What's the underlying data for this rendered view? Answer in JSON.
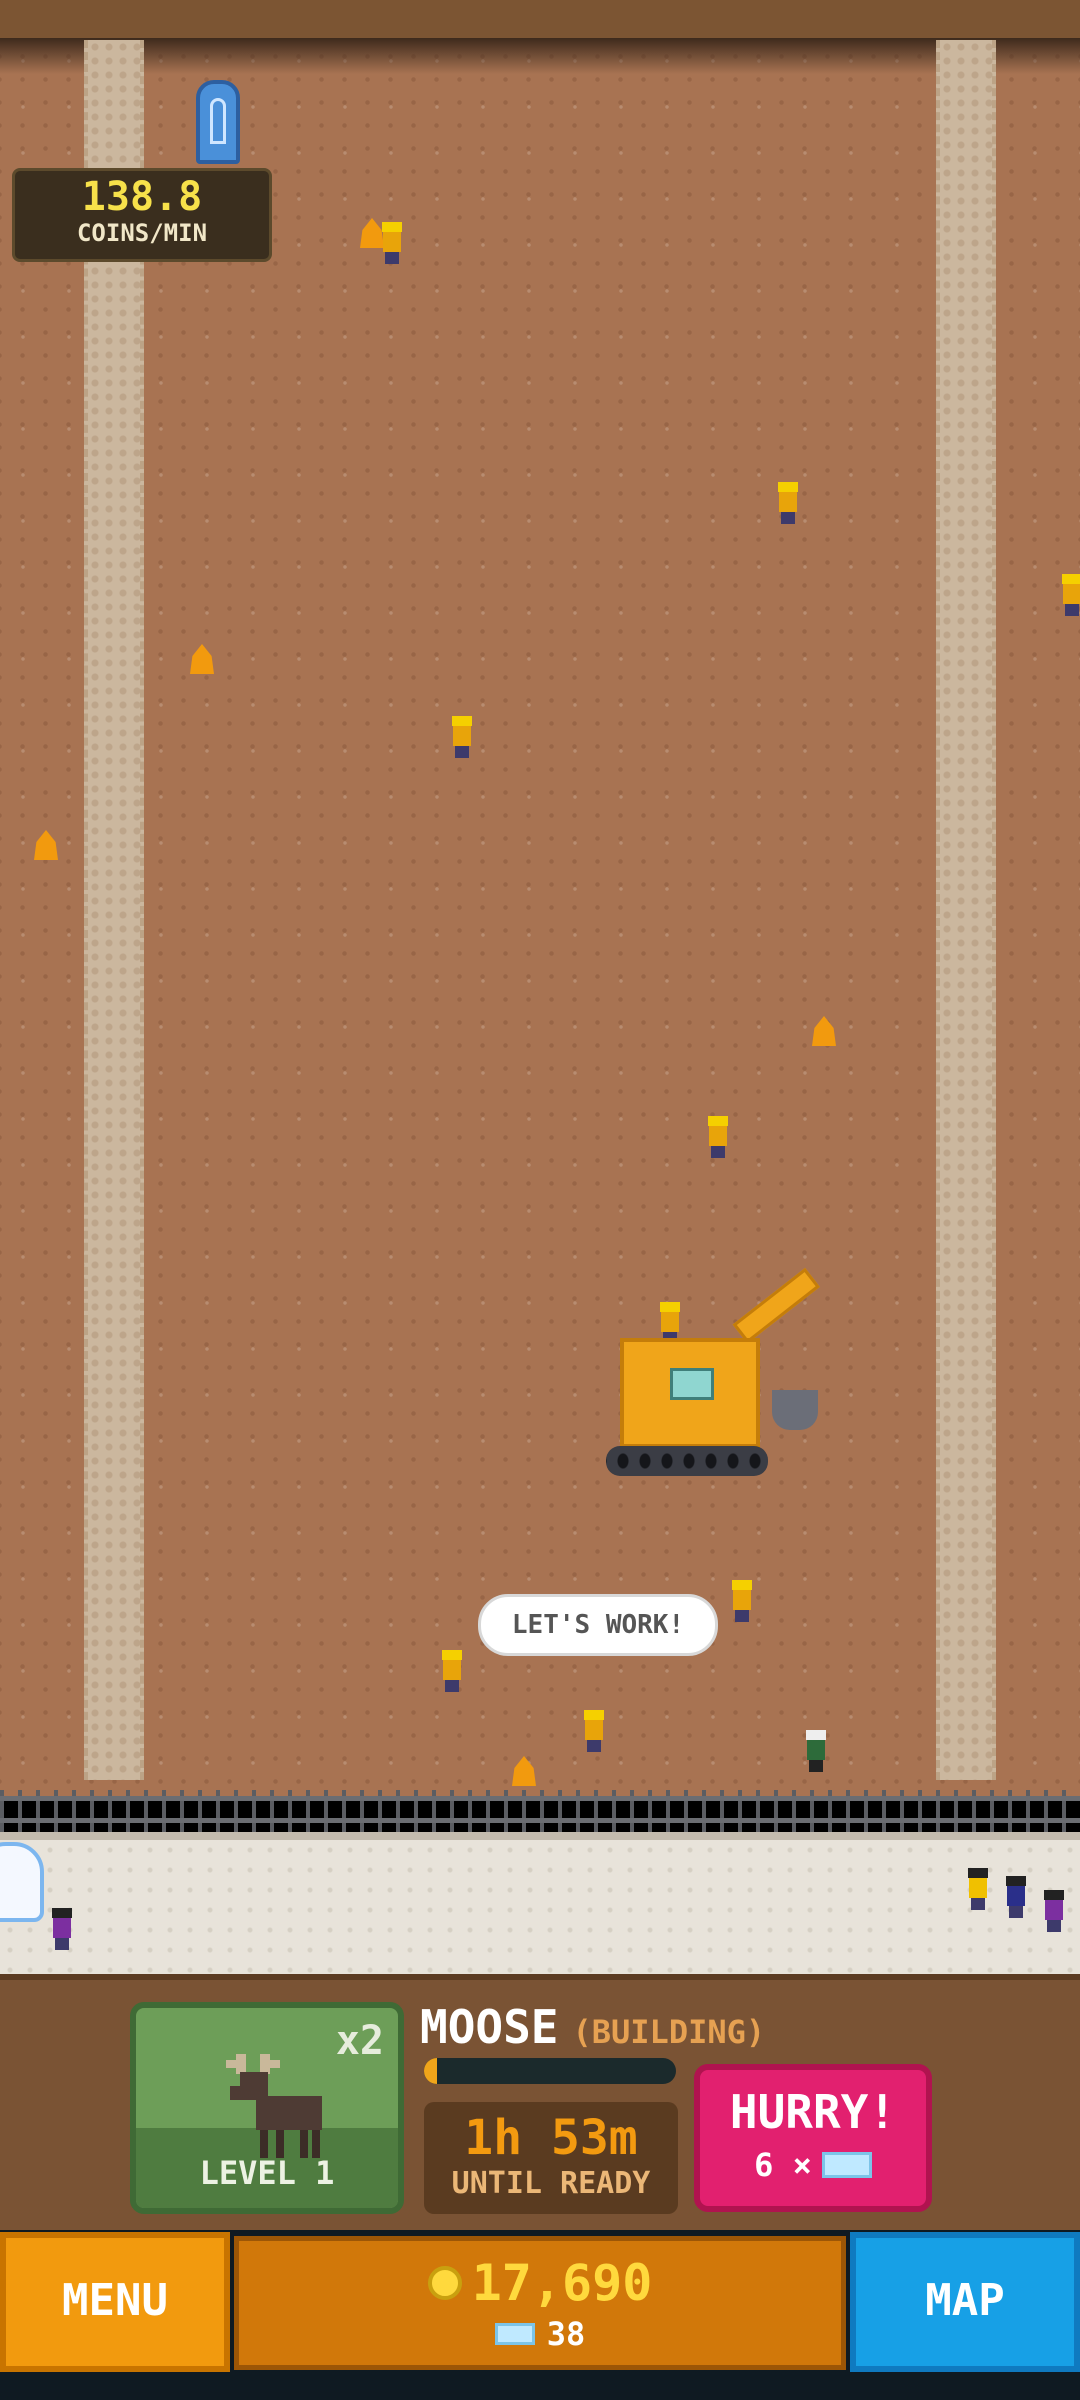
{
  "hud": {
    "coins_rate_value": "138.8",
    "coins_rate_label": "COINS/MIN"
  },
  "speech_bubble": "LET'S WORK!",
  "building": {
    "name": "MOOSE",
    "status": "(BUILDING)",
    "multiplier": "x2",
    "level": "LEVEL 1",
    "progress": 0.05,
    "time_left": "1h 53m",
    "time_label": "UNTIL READY",
    "hurry_label": "HURRY!",
    "hurry_cost": "6 ×"
  },
  "footer": {
    "menu_label": "MENU",
    "map_label": "MAP",
    "coins": "17,690",
    "gems": "38"
  },
  "colors": {
    "dirt": "#a87352",
    "hurry": "#e2206f",
    "menu": "#f29a0e",
    "map": "#17a0e6",
    "coin_text": "#ffd93d"
  },
  "icons": [
    "coin-icon",
    "gem-icon",
    "moose-icon",
    "excavator-icon",
    "portal-sign-icon"
  ]
}
